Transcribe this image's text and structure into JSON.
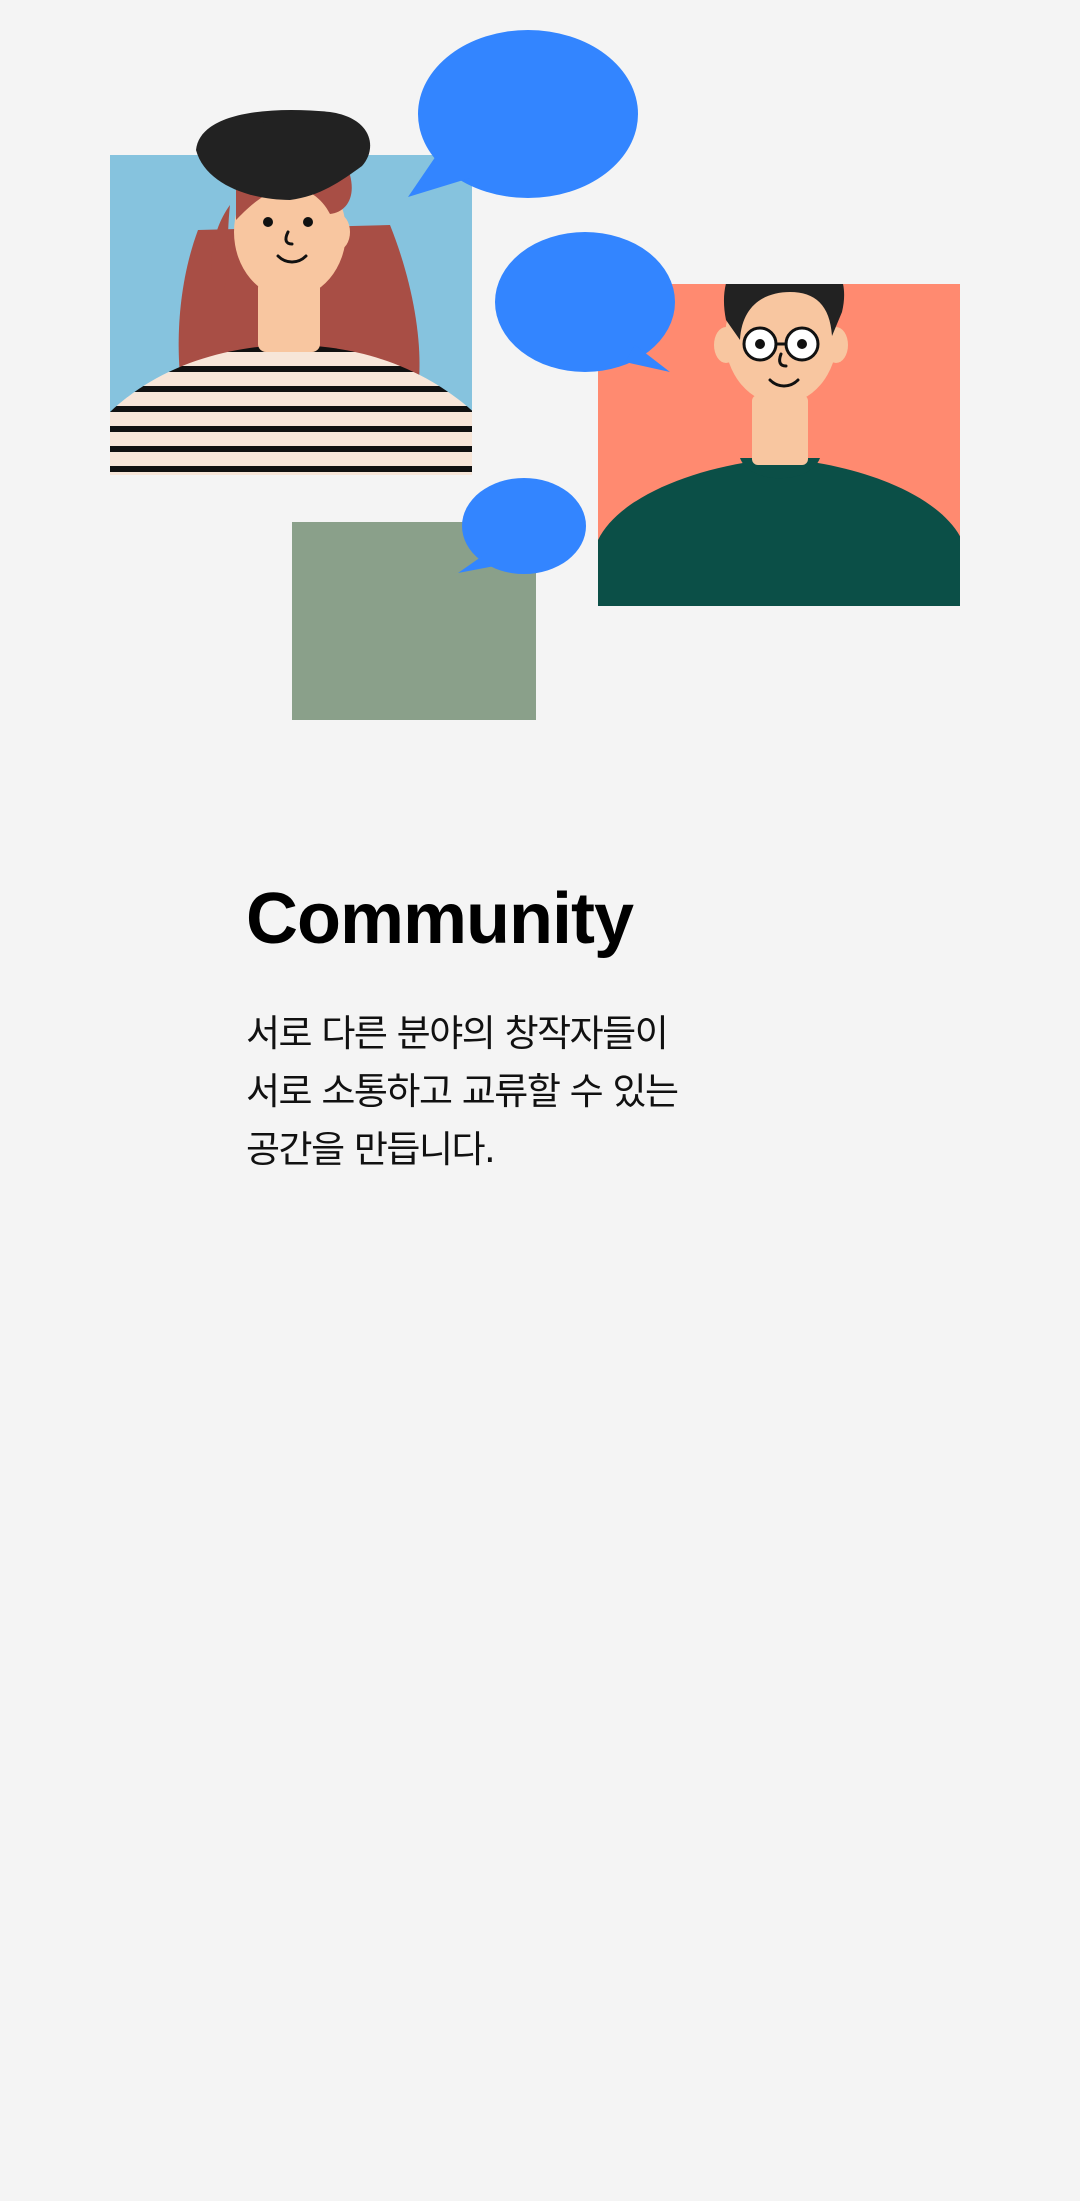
{
  "onboarding": {
    "title": "Community",
    "description_lines": [
      "서로 다른 분야의 창작자들이",
      "서로 소통하고 교류할 수 있는",
      "공간을 만듭니다."
    ]
  },
  "illustration": {
    "icons": [
      "woman-avatar-icon",
      "man-avatar-icon",
      "empty-avatar-icon",
      "speech-bubble-icon"
    ],
    "colors": {
      "background": "#f4f4f4",
      "bubble": "#3385ff",
      "woman_card": "#86c3de",
      "man_card": "#ff8a70",
      "empty_card": "#8aa08a",
      "sweater": "#0b4f47",
      "hair_woman": "#a84e45",
      "beret": "#222222",
      "skin": "#f8c6a0"
    }
  }
}
